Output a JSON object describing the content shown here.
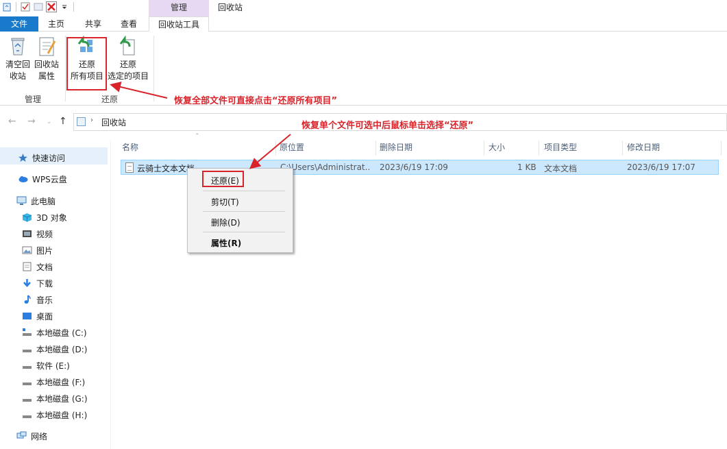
{
  "titlebar": {
    "context_tab": "管理",
    "window_title": "回收站"
  },
  "tabs": [
    {
      "label": "文件"
    },
    {
      "label": "主页"
    },
    {
      "label": "共享"
    },
    {
      "label": "查看"
    },
    {
      "label": "回收站工具"
    }
  ],
  "ribbon": {
    "empty_bin": {
      "line1": "清空回",
      "line2": "收站"
    },
    "bin_props": {
      "line1": "回收站",
      "line2": "属性"
    },
    "restore_all": {
      "line1": "还原",
      "line2": "所有项目"
    },
    "restore_selected": {
      "line1": "还原",
      "line2": "选定的项目"
    },
    "group_manage": "管理",
    "group_restore": "还原"
  },
  "address": {
    "crumb": "回收站"
  },
  "navpane": {
    "items": [
      {
        "label": "快速访问",
        "icon": "star-icon"
      },
      {
        "label": "WPS云盘",
        "icon": "cloud-icon"
      },
      {
        "label": "此电脑",
        "icon": "pc-icon"
      },
      {
        "label": "3D 对象",
        "icon": "cube-icon"
      },
      {
        "label": "视频",
        "icon": "video-icon"
      },
      {
        "label": "图片",
        "icon": "picture-icon"
      },
      {
        "label": "文档",
        "icon": "document-icon"
      },
      {
        "label": "下载",
        "icon": "download-icon"
      },
      {
        "label": "音乐",
        "icon": "music-icon"
      },
      {
        "label": "桌面",
        "icon": "desktop-icon"
      },
      {
        "label": "本地磁盘 (C:)",
        "icon": "drive-icon"
      },
      {
        "label": "本地磁盘 (D:)",
        "icon": "drive-icon"
      },
      {
        "label": "软件 (E:)",
        "icon": "drive-icon"
      },
      {
        "label": "本地磁盘 (F:)",
        "icon": "drive-icon"
      },
      {
        "label": "本地磁盘 (G:)",
        "icon": "drive-icon"
      },
      {
        "label": "本地磁盘 (H:)",
        "icon": "drive-icon"
      },
      {
        "label": "网络",
        "icon": "network-icon"
      }
    ]
  },
  "columns": [
    "名称",
    "原位置",
    "删除日期",
    "大小",
    "项目类型",
    "修改日期"
  ],
  "files": [
    {
      "name": "云骑士文本文档",
      "original_location": "C:\\Users\\Administrat...",
      "deleted_date": "2023/6/19 17:09",
      "size": "1 KB",
      "type": "文本文档",
      "modified_date": "2023/6/19 17:07"
    }
  ],
  "context_menu": {
    "restore": "还原(E)",
    "cut": "剪切(T)",
    "delete": "删除(D)",
    "properties": "属性(R)"
  },
  "annotations": {
    "restore_all_tip": "恢复全部文件可直接点击“还原所有项目”",
    "restore_single_tip": "恢复单个文件可选中后鼠标单击选择“还原”"
  },
  "colors": {
    "file_tab": "#1979ca",
    "context_tab": "#e7d8f4",
    "selection": "#cce8ff",
    "annotation": "#d8232a"
  }
}
